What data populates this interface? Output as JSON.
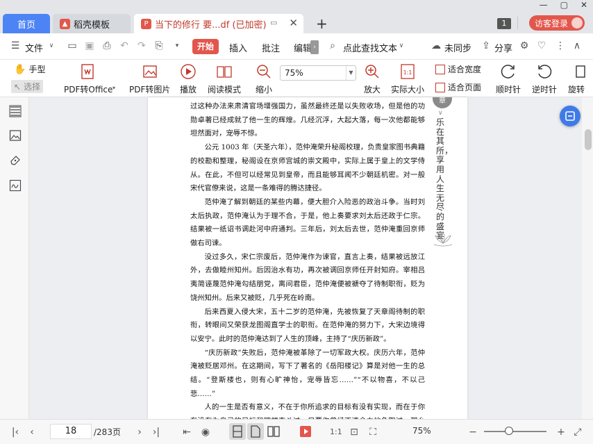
{
  "tabs": {
    "home": "首页",
    "template": "稻壳模板",
    "document": "当下的修行 要...df (已加密)"
  },
  "header": {
    "page_badge": "1",
    "login": "访客登录"
  },
  "menu": {
    "file": "文件",
    "start": "开始",
    "insert": "插入",
    "annotate": "批注",
    "edit": "编辑",
    "search": "点此查找文本",
    "sync": "未同步",
    "share": "分享"
  },
  "ribbon": {
    "hand": "手型",
    "select": "选择",
    "pdf_to_office": "PDF转Office",
    "pdf_to_image": "PDF转图片",
    "play": "播放",
    "read_mode": "阅读模式",
    "zoom_out": "缩小",
    "zoom_value": "75%",
    "zoom_in": "放大",
    "actual_size": "实际大小",
    "fit_width": "适合宽度",
    "fit_page": "适合页面",
    "rotate_cw": "顺时针",
    "rotate_ccw": "逆时针",
    "rotate_doc": "旋转"
  },
  "document": {
    "paragraphs": [
      {
        "indent": false,
        "text": "过这种办法来肃清官场增强国力，虽然最终还是以失败收场，但是他的功勋卓著已经成就了他一生的辉煌。几经沉浮，大起大落，每一次他都能够坦然面对，宠辱不惊。"
      },
      {
        "indent": true,
        "text": "公元 1003 年（天圣六年），范仲淹荣升秘阁校理，负责皇家图书典籍的校勘和整理，秘阁设在京师宫城的崇文殿中，实际上属于皇上的文学侍从。在此，不但可以经常见到皇帝，而且能够耳闻不少朝廷机密。对一般宋代官僚来说，这是一条难得的腾达捷径。"
      },
      {
        "indent": true,
        "text": "范仲淹了解到朝廷的某些内幕，便大胆介入险恶的政治斗争。当时刘太后执政，范仲淹认为于理不合，于是，他上奏要求刘太后还政于仁宗。结果被一纸诏书调赴河中府通判。三年后，刘太后去世，范仲淹重回京师做右司谏。"
      },
      {
        "indent": true,
        "text": "没过多久，宋仁宗废后，范仲淹作为谏官，直言上奏，结果被远放江外，去做睦州知州。后因治水有功，再次被调回京师任开封知府。宰相吕夷简诬蔑范仲淹勾结朋党，离间君臣，范仲淹便被褫夺了待制职衔，贬为饶州知州。后来又被贬，几乎死在岭南。"
      },
      {
        "indent": true,
        "text": "后来西夏入侵大宋，五十二岁的范仲淹，先被恢复了天章阁待制的职衔，转眼间又荣获龙图阁直学士的职衔。在范仲淹的努力下，大宋边境得以安宁。此时的范仲淹达到了人生的顶峰，主持了“庆历新政”。"
      },
      {
        "indent": true,
        "text": "“庆历新政”失败后，范仲淹被革除了一切军政大权。庆历六年，范仲淹被贬居邓州。在这期间，写下了著名的《岳阳楼记》算是对他一生的总结。“登斯楼也，则有心旷神怡，宠辱皆忘……”“不以物喜，不以己悲……”"
      },
      {
        "indent": true,
        "text": "人的一生是否有意义，不在于你所追求的目标有没有实现，而在于你有没有为自己的目标和理想奋斗过，只要你曾经不遗余力地争取过，那么你的"
      }
    ],
    "chapter_mark": "章",
    "side_title": "乐在其所，享用人生无尽的盛宴"
  },
  "statusbar": {
    "current_page": "18",
    "total_pages": "/283页",
    "zoom": "75%"
  },
  "colors": {
    "accent": "#e2574c",
    "tab_blue": "#4d84f5",
    "float_btn": "#3f7be8"
  }
}
